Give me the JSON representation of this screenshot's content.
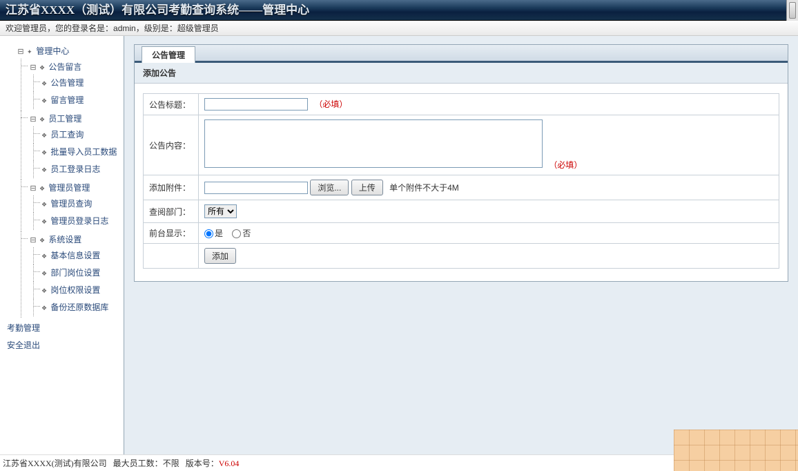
{
  "header": {
    "title": "江苏省XXXX（测试）有限公司考勤查询系统——管理中心"
  },
  "welcome": {
    "prefix": "欢迎管理员，您的登录名是：",
    "username": "admin",
    "level_prefix": "，级别是：",
    "level": "超级管理员"
  },
  "tree": {
    "root": "管理中心",
    "n1": "公告留言",
    "n1a": "公告管理",
    "n1b": "留言管理",
    "n2": "员工管理",
    "n2a": "员工查询",
    "n2b": "批量导入员工数据",
    "n2c": "员工登录日志",
    "n3": "管理员管理",
    "n3a": "管理员查询",
    "n3b": "管理员登录日志",
    "n4": "系统设置",
    "n4a": "基本信息设置",
    "n4b": "部门岗位设置",
    "n4c": "岗位权限设置",
    "n4d": "备份还原数据库",
    "link1": "考勤管理",
    "link2": "安全退出"
  },
  "panel": {
    "tab": "公告管理",
    "section": "添加公告",
    "title_label": "公告标题：",
    "content_label": "公告内容：",
    "attach_label": "添加附件：",
    "browse_btn": "浏览...",
    "upload_btn": "上传",
    "attach_hint": "单个附件不大于4M",
    "dept_label": "查阅部门：",
    "dept_option": "所有",
    "show_label": "前台显示：",
    "radio_yes": "是",
    "radio_no": "否",
    "submit_btn": "添加",
    "required": "（必填）"
  },
  "footer": {
    "company": "江苏省XXXX(测试)有限公司",
    "max_label": "最大员工数：",
    "max_value": "不限",
    "ver_label": "版本号：",
    "ver_value": "V6.04"
  }
}
